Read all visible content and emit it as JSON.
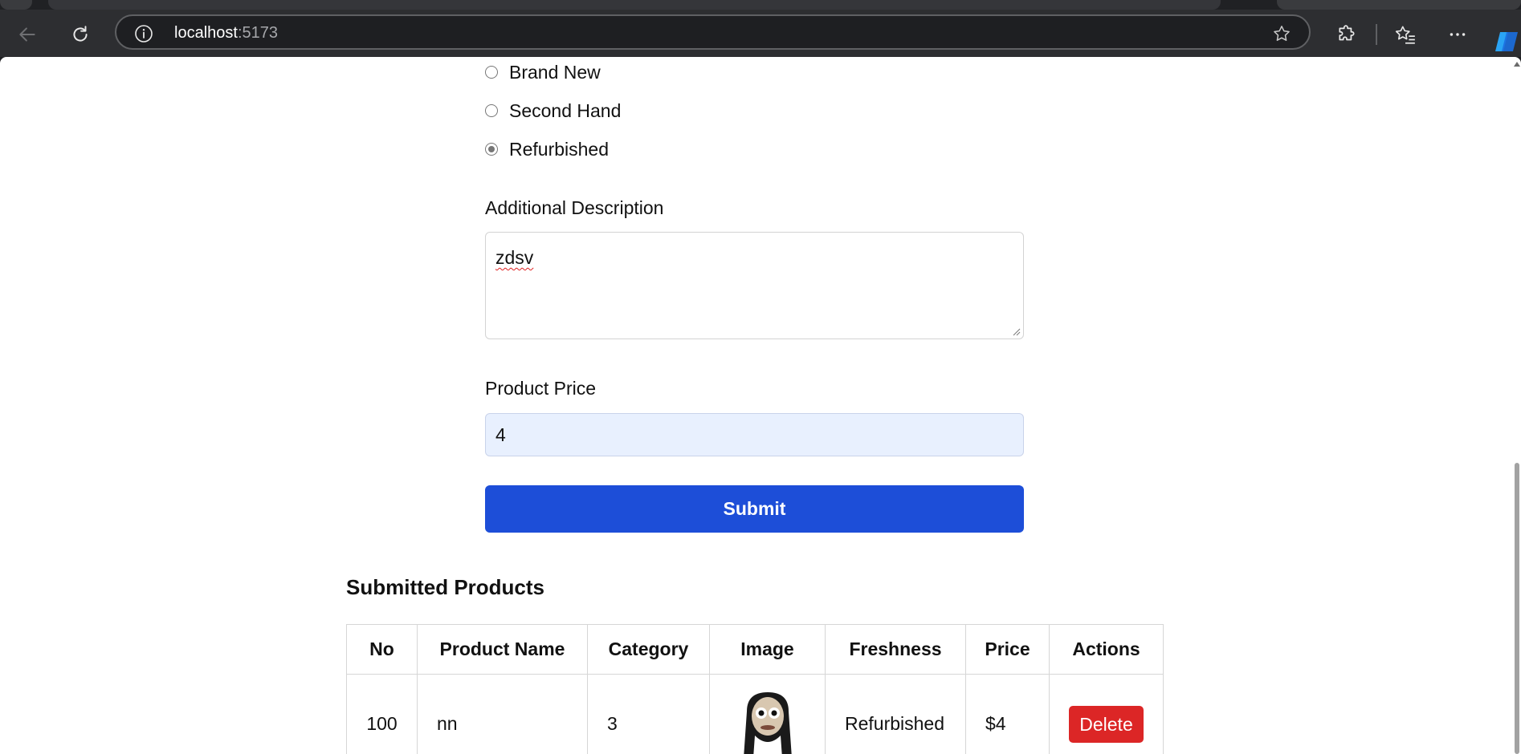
{
  "browser": {
    "url_host": "localhost",
    "url_port": ":5173"
  },
  "form": {
    "condition_options": [
      {
        "label": "Brand New",
        "checked": false
      },
      {
        "label": "Second Hand",
        "checked": false
      },
      {
        "label": "Refurbished",
        "checked": true
      }
    ],
    "description_label": "Additional Description",
    "description_value": "zdsv",
    "price_label": "Product Price",
    "price_value": "4",
    "submit_label": "Submit"
  },
  "products": {
    "title": "Submitted Products",
    "columns": [
      "No",
      "Product Name",
      "Category",
      "Image",
      "Freshness",
      "Price",
      "Actions"
    ],
    "rows": [
      {
        "no": "100",
        "name": "nn",
        "category": "3",
        "image_icon": "product-photo",
        "freshness": "Refurbished",
        "price": "$4",
        "action_label": "Delete"
      }
    ]
  },
  "colors": {
    "primary": "#1d4ed8",
    "danger": "#dc2626",
    "input_autofill": "#e8f0fe"
  }
}
